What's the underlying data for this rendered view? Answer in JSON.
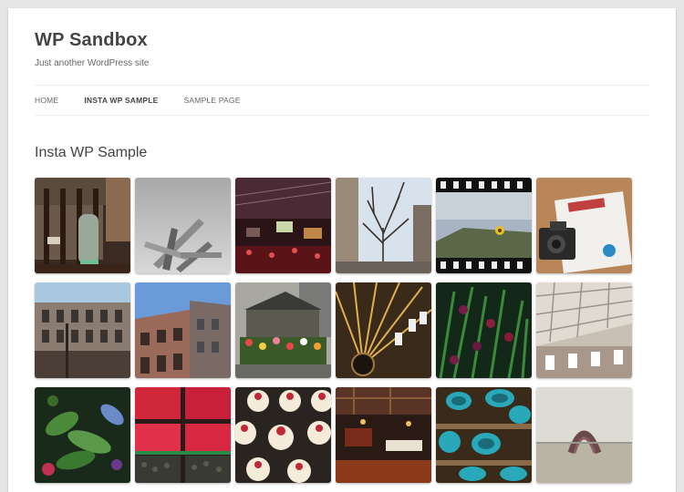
{
  "site": {
    "title": "WP Sandbox",
    "tagline": "Just another WordPress site"
  },
  "nav": {
    "items": [
      {
        "label": "HOME",
        "active": false
      },
      {
        "label": "INSTA WP SAMPLE",
        "active": true
      },
      {
        "label": "SAMPLE PAGE",
        "active": false
      }
    ]
  },
  "page": {
    "heading": "Insta WP Sample"
  },
  "photos": [
    {
      "name": "storefront-window-photo"
    },
    {
      "name": "metal-sculpture-photo"
    },
    {
      "name": "concert-hall-photo"
    },
    {
      "name": "bare-tree-buildings-photo"
    },
    {
      "name": "film-strip-flowers-photo"
    },
    {
      "name": "film-scanner-photo"
    },
    {
      "name": "victorian-building-photo"
    },
    {
      "name": "brick-building-photo"
    },
    {
      "name": "flower-market-stall-photo"
    },
    {
      "name": "market-ceiling-photo"
    },
    {
      "name": "purple-flowers-photo"
    },
    {
      "name": "arcade-ceiling-photo"
    },
    {
      "name": "green-plants-photo"
    },
    {
      "name": "raspberries-market-photo"
    },
    {
      "name": "cupcakes-photo"
    },
    {
      "name": "public-market-sign-photo"
    },
    {
      "name": "teal-pottery-photo"
    },
    {
      "name": "beach-sculpture-photo"
    }
  ],
  "colors": {
    "background": "#e6e6e6",
    "page": "#ffffff",
    "title": "#444444"
  }
}
